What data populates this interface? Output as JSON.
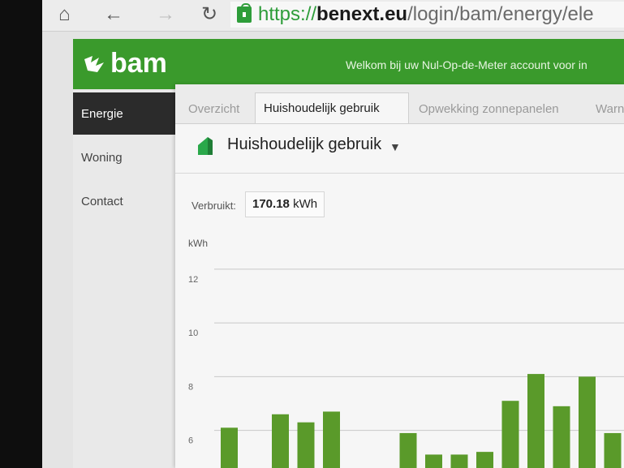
{
  "browser": {
    "home_icon": "home-icon",
    "back_icon": "arrow-left-icon",
    "forward_icon": "arrow-right-icon",
    "reload_icon": "reload-icon",
    "url": {
      "scheme": "https://",
      "domain": "benext.eu",
      "path": "/login/bam/energy/ele"
    }
  },
  "header": {
    "logo": "bam",
    "welcome": "Welkom bij uw Nul-Op-de-Meter account voor in",
    "color": "#3a9a2c"
  },
  "sidebar": {
    "items": [
      {
        "label": "Energie",
        "active": true
      },
      {
        "label": "Woning",
        "active": false
      },
      {
        "label": "Contact",
        "active": false
      }
    ]
  },
  "tabs": [
    {
      "label": "Overzicht",
      "active": false
    },
    {
      "label": "Huishoudelijk gebruik",
      "active": true
    },
    {
      "label": "Opwekking zonnepanelen",
      "active": false
    },
    {
      "label": "Warn",
      "active": false
    }
  ],
  "section": {
    "title": "Huishoudelijk gebruik",
    "icon": "house-icon",
    "caret": "▼"
  },
  "consumption": {
    "label": "Verbruikt:",
    "value": "170.18",
    "unit": "kWh"
  },
  "chart_data": {
    "type": "bar",
    "ylabel": "kWh",
    "yticks": [
      6,
      8,
      10,
      12
    ],
    "ylim": [
      4.6,
      12.3
    ],
    "grid": true,
    "color": "#5a9a2a",
    "values": [
      6.1,
      null,
      6.6,
      6.3,
      6.7,
      null,
      null,
      5.9,
      5.1,
      5.1,
      5.2,
      7.1,
      8.1,
      6.9,
      8.0,
      5.9,
      6.3
    ]
  }
}
